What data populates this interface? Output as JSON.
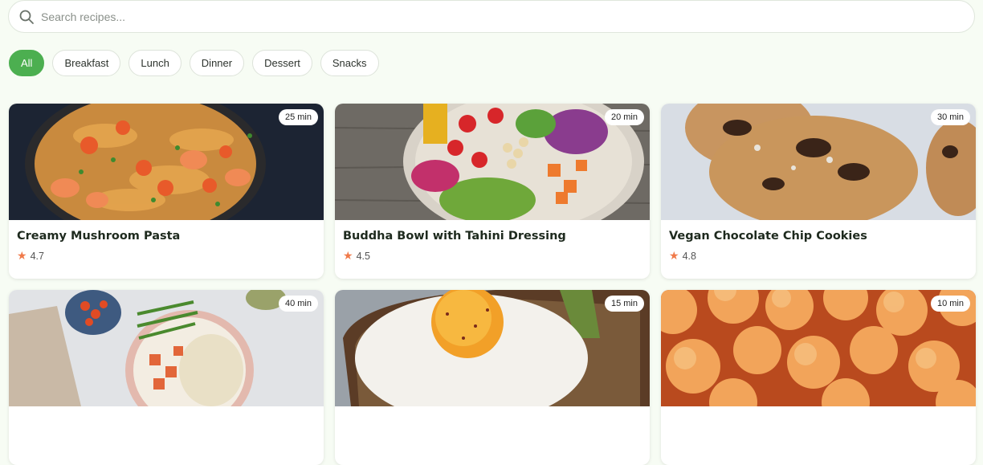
{
  "search": {
    "placeholder": "Search recipes..."
  },
  "filters": [
    "All",
    "Breakfast",
    "Lunch",
    "Dinner",
    "Dessert",
    "Snacks"
  ],
  "colors": {
    "accent": "#4caf50",
    "star": "#f07a4a",
    "background": "#f7fcf4"
  },
  "recipes": [
    {
      "title": "Creamy Mushroom Pasta",
      "time": "25 min",
      "rating": "4.7"
    },
    {
      "title": "Buddha Bowl with Tahini Dressing",
      "time": "20 min",
      "rating": "4.5"
    },
    {
      "title": "Vegan Chocolate Chip Cookies",
      "time": "30 min",
      "rating": "4.8"
    },
    {
      "title": "",
      "time": "40 min",
      "rating": ""
    },
    {
      "title": "",
      "time": "15 min",
      "rating": ""
    },
    {
      "title": "",
      "time": "10 min",
      "rating": ""
    }
  ]
}
